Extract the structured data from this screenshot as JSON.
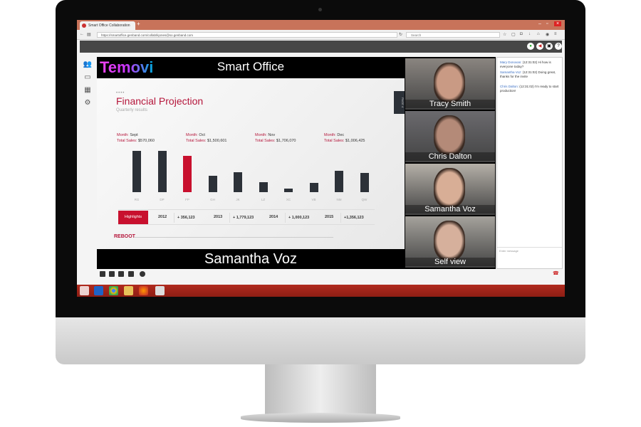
{
  "browser": {
    "tab_title": "Smart Office Collaboration",
    "url": "https://smartoffice.genband.com/collab/kjones@so.genband.com",
    "search_placeholder": "Search"
  },
  "presentation": {
    "logo": "Temovi",
    "title": "Smart Office",
    "presenter": "Samantha Voz",
    "page_tab": "PAGE 4"
  },
  "slide": {
    "dots": "••••",
    "title": "Financial Projection",
    "subtitle": "Quarterly results",
    "months": [
      {
        "month_label": "Month:",
        "month": "Sept",
        "sales_label": "Total Sales:",
        "sales": "$570,060"
      },
      {
        "month_label": "Month:",
        "month": "Oct",
        "sales_label": "Total Sales:",
        "sales": "$1,500,601"
      },
      {
        "month_label": "Month:",
        "month": "Nov",
        "sales_label": "Total Sales:",
        "sales": "$1,706,070"
      },
      {
        "month_label": "Month:",
        "month": "Dec",
        "sales_label": "Total Sales:",
        "sales": "$1,006,425"
      }
    ],
    "highlights_label": "Highlights",
    "highlights": [
      {
        "year": "2012",
        "value": "+ 356,123"
      },
      {
        "year": "2013",
        "value": "+ 1,779,123"
      },
      {
        "year": "2014",
        "value": "+ 1,000,123"
      },
      {
        "year": "2015",
        "value": "+1,356,123"
      }
    ],
    "brand": "REBOOT"
  },
  "chart_data": {
    "type": "bar",
    "categories": [
      "RG",
      "DP",
      "FP",
      "GH",
      "JK",
      "LZ",
      "XC",
      "VB",
      "NM",
      "QW"
    ],
    "values": [
      100,
      100,
      88,
      39,
      49,
      25,
      8,
      22,
      51,
      47
    ],
    "highlighted": "FP",
    "colors": {
      "bar": "#2c3138",
      "highlight": "#c8102e"
    }
  },
  "videos": [
    {
      "name": "Tracy Smith"
    },
    {
      "name": "Chris Dalton"
    },
    {
      "name": "Samantha Voz"
    },
    {
      "name": "Self view"
    }
  ],
  "chat": {
    "messages": [
      {
        "sender": "Mary Donovan:",
        "text": "(12:31:02) Hi how is everyone today?"
      },
      {
        "sender": "Samantha Voz:",
        "text": "(12:31:02) Doing great, thanks for the invite"
      },
      {
        "sender": "Chris Dalton:",
        "text": "(12:31:02) I'm ready to start production!"
      }
    ],
    "input_placeholder": "Enter message"
  }
}
